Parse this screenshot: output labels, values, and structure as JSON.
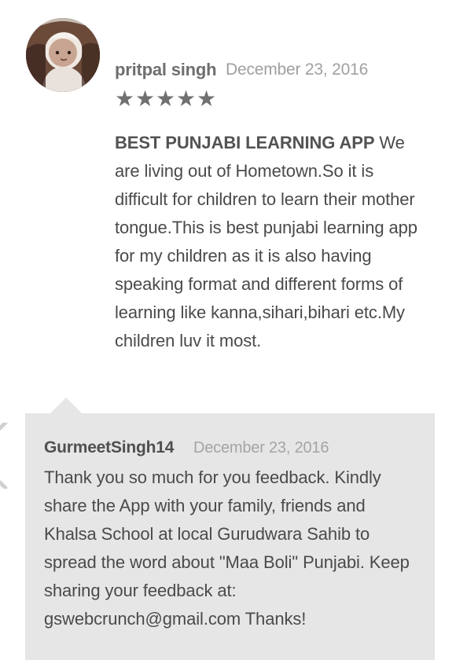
{
  "review": {
    "author": "pritpal singh",
    "date": "December 23, 2016",
    "rating": 5,
    "stars": [
      "★",
      "★",
      "★",
      "★",
      "★"
    ],
    "title": "BEST PUNJABI LEARNING APP",
    "text": " We are living out of Hometown.So it is difficult for children to learn their mother tongue.This is best punjabi learning app for my children as it is also having speaking format and different forms of learning like kanna,sihari,bihari etc.My children luv it most."
  },
  "reply": {
    "author": "GurmeetSingh14",
    "date": "December 23, 2016",
    "text": "Thank you so much for you feedback. Kindly share the App with your family, friends and Khalsa School at local Gurudwara Sahib to spread the word about \"Maa Boli\" Punjabi. Keep sharing your feedback at: gswebcrunch@gmail.com Thanks!"
  },
  "colors": {
    "reply_background": "#e6e6e6",
    "star": "#707070",
    "author": "#6e6e6e",
    "date": "#a0a0a0",
    "body": "#4a4a4a"
  },
  "icons": {
    "avatar": "child-profile-photo",
    "rating": "star-icon",
    "edge": "partial-close-icon"
  }
}
